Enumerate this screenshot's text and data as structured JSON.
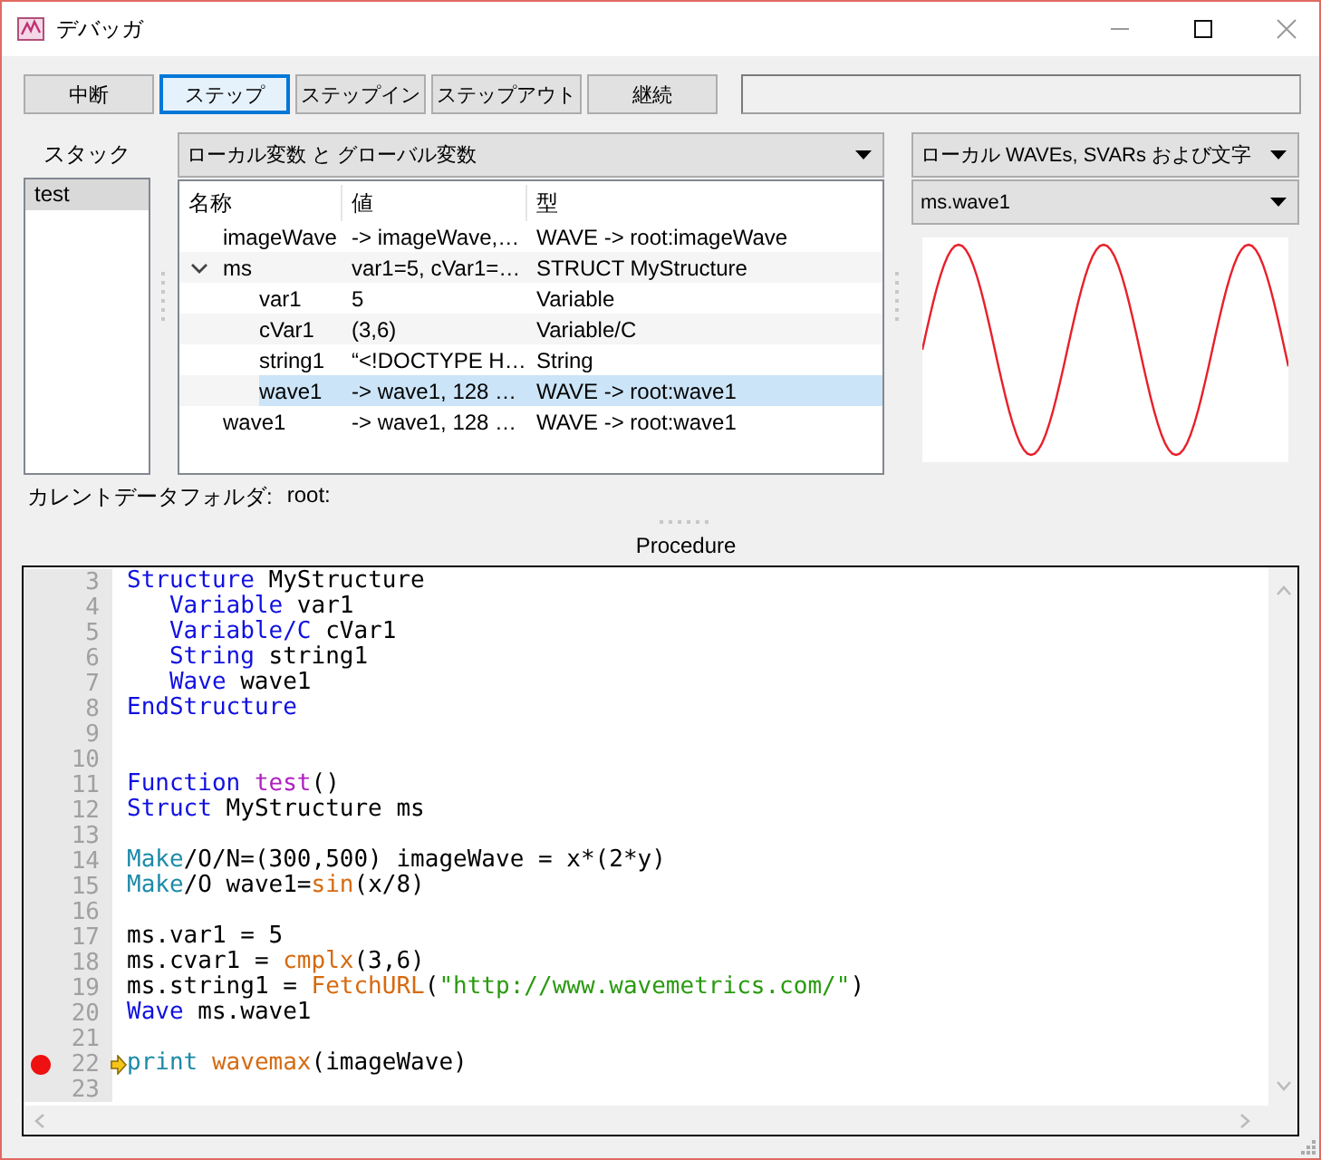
{
  "window": {
    "title": "デバッガ"
  },
  "toolbar": {
    "buttons": [
      {
        "label": "中断",
        "selected": false
      },
      {
        "label": "ステップ",
        "selected": true
      },
      {
        "label": "ステップイン",
        "selected": false
      },
      {
        "label": "ステップアウト",
        "selected": false
      },
      {
        "label": "継続",
        "selected": false
      }
    ]
  },
  "stack": {
    "label": "スタック",
    "items": [
      {
        "label": "test",
        "selected": true
      }
    ]
  },
  "variables": {
    "scope_dropdown": "ローカル変数 と グローバル変数",
    "columns": [
      "名称",
      "値",
      "型"
    ],
    "rows": [
      {
        "name": "imageWave",
        "value": "-> imageWave,…",
        "type": "WAVE -> root:imageWave",
        "selected": false
      },
      {
        "name": "ms",
        "value": "var1=5, cVar1=…",
        "type": "STRUCT MyStructure",
        "selected": false,
        "expanded": true,
        "children": [
          {
            "name": "var1",
            "value": "5",
            "type": "Variable",
            "selected": false
          },
          {
            "name": "cVar1",
            "value": "(3,6)",
            "type": "Variable/C",
            "selected": false
          },
          {
            "name": "string1",
            "value": "“<!DOCTYPE H…",
            "type": "String",
            "selected": false
          },
          {
            "name": "wave1",
            "value": "-> wave1, 128 …",
            "type": "WAVE -> root:wave1",
            "selected": true
          }
        ]
      },
      {
        "name": "wave1",
        "value": "-> wave1, 128 …",
        "type": "WAVE -> root:wave1",
        "selected": false
      }
    ]
  },
  "waves": {
    "scope_dropdown": "ローカル WAVEs, SVARs および文字",
    "wave_dropdown": "ms.wave1"
  },
  "current_folder": {
    "label": "カレントデータフォルダ:",
    "value": "root:"
  },
  "procedure": {
    "title": "Procedure",
    "lines": [
      {
        "num": "3",
        "tokens": [
          {
            "kind": "keyword",
            "text": "Structure"
          },
          {
            "kind": "plain",
            "text": " MyStructure"
          }
        ]
      },
      {
        "num": "4",
        "indented": true,
        "tokens": [
          {
            "kind": "keyword",
            "text": "Variable"
          },
          {
            "kind": "plain",
            "text": " var1"
          }
        ]
      },
      {
        "num": "5",
        "indented": true,
        "tokens": [
          {
            "kind": "keyword",
            "text": "Variable/C"
          },
          {
            "kind": "plain",
            "text": " cVar1"
          }
        ]
      },
      {
        "num": "6",
        "indented": true,
        "tokens": [
          {
            "kind": "keyword",
            "text": "String"
          },
          {
            "kind": "plain",
            "text": " string1"
          }
        ]
      },
      {
        "num": "7",
        "indented": true,
        "tokens": [
          {
            "kind": "keyword",
            "text": "Wave"
          },
          {
            "kind": "plain",
            "text": " wave1"
          }
        ]
      },
      {
        "num": "8",
        "tokens": [
          {
            "kind": "keyword",
            "text": "EndStructure"
          }
        ]
      },
      {
        "num": "9"
      },
      {
        "num": "10"
      },
      {
        "num": "11",
        "tokens": [
          {
            "kind": "keyword",
            "text": "Function"
          },
          {
            "kind": "userfunc",
            "text": " test"
          },
          {
            "kind": "plain",
            "text": "()"
          }
        ]
      },
      {
        "num": "12",
        "tokens": [
          {
            "kind": "keyword",
            "text": "Struct"
          },
          {
            "kind": "plain",
            "text": " MyStructure ms"
          }
        ]
      },
      {
        "num": "13"
      },
      {
        "num": "14",
        "tokens": [
          {
            "kind": "operation",
            "text": "Make"
          },
          {
            "kind": "plain",
            "text": "/O/N=(300,500) imageWave = x*(2*y)"
          }
        ]
      },
      {
        "num": "15",
        "tokens": [
          {
            "kind": "operation",
            "text": "Make"
          },
          {
            "kind": "plain",
            "text": "/O wave1="
          },
          {
            "kind": "builtin",
            "text": "sin"
          },
          {
            "kind": "plain",
            "text": "(x/8)"
          }
        ]
      },
      {
        "num": "16"
      },
      {
        "num": "17",
        "tokens": [
          {
            "kind": "plain",
            "text": "ms.var1 = 5"
          }
        ]
      },
      {
        "num": "18",
        "tokens": [
          {
            "kind": "plain",
            "text": "ms.cvar1 = "
          },
          {
            "kind": "builtin",
            "text": "cmplx"
          },
          {
            "kind": "plain",
            "text": "(3,6)"
          }
        ]
      },
      {
        "num": "19",
        "tokens": [
          {
            "kind": "plain",
            "text": "ms.string1 = "
          },
          {
            "kind": "builtin",
            "text": "FetchURL"
          },
          {
            "kind": "plain",
            "text": "("
          },
          {
            "kind": "string",
            "text": "\"http://www.wavemetrics.com/\""
          },
          {
            "kind": "plain",
            "text": ")"
          }
        ]
      },
      {
        "num": "20",
        "tokens": [
          {
            "kind": "keyword",
            "text": "Wave"
          },
          {
            "kind": "plain",
            "text": " ms.wave1"
          }
        ]
      },
      {
        "num": "21"
      },
      {
        "num": "22",
        "breakpoint": true,
        "current": true,
        "tokens": [
          {
            "kind": "operation",
            "text": "print"
          },
          {
            "kind": "builtin",
            "text": " wavemax"
          },
          {
            "kind": "plain",
            "text": "(imageWave)"
          }
        ]
      },
      {
        "num": "23"
      }
    ]
  }
}
